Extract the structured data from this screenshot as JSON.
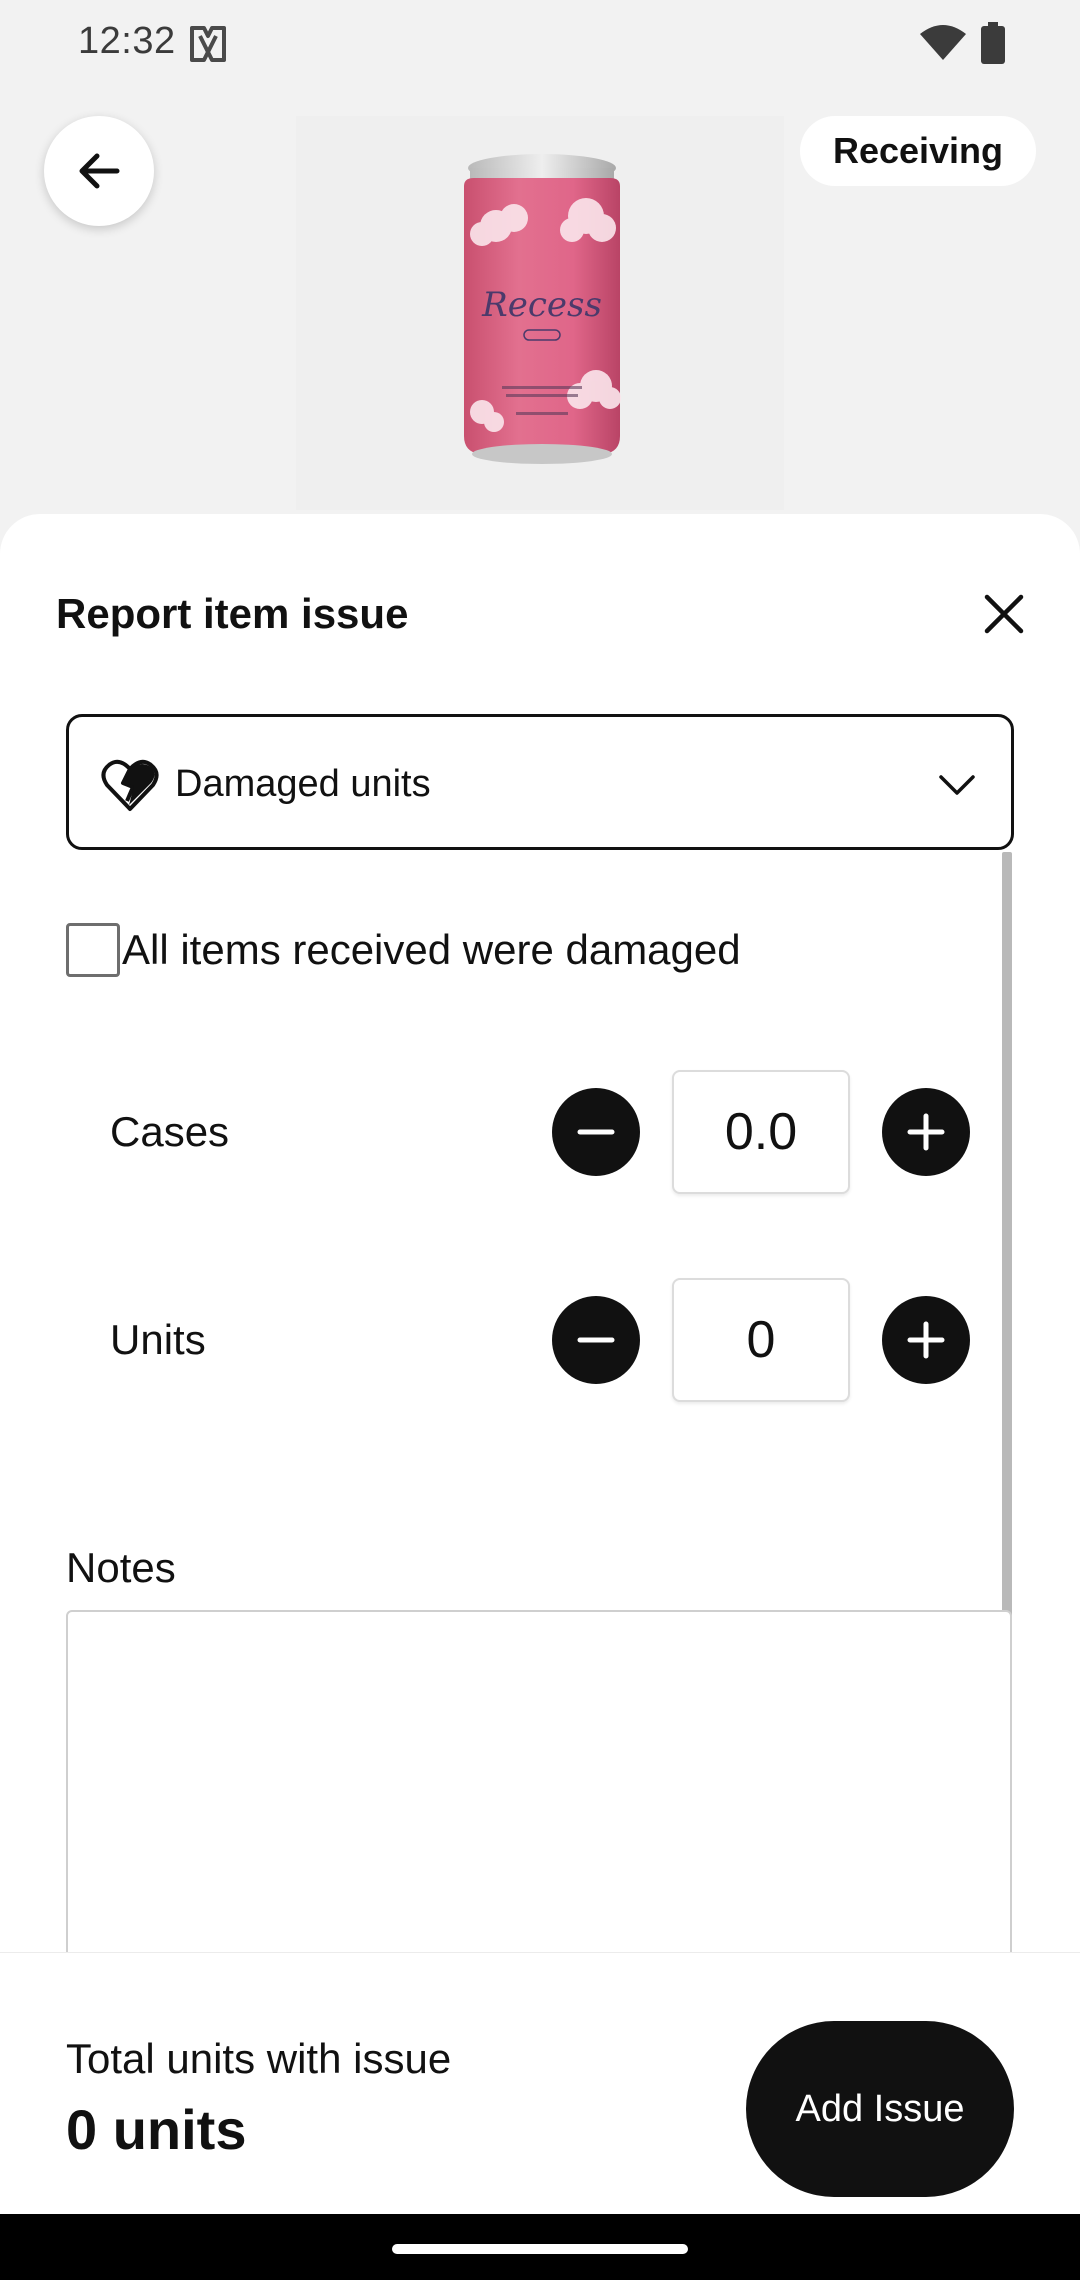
{
  "status_bar": {
    "time": "12:32",
    "app_icon": "app-logo-icon",
    "wifi_icon": "wifi-icon",
    "battery_icon": "battery-icon"
  },
  "header": {
    "back_icon": "arrow-left-icon",
    "chip_label": "Receiving",
    "product_image": "Recess sparkling water can"
  },
  "sheet": {
    "title": "Report item issue",
    "close_icon": "close-icon",
    "issue_type": {
      "selected": "Damaged units",
      "icon": "broken-heart-icon",
      "dropdown_icon": "chevron-down-icon"
    },
    "all_damaged": {
      "label": "All items received were damaged",
      "checked": false
    },
    "quantities": [
      {
        "label": "Cases",
        "value": "0.0"
      },
      {
        "label": "Units",
        "value": "0"
      }
    ],
    "notes": {
      "label": "Notes",
      "value": ""
    }
  },
  "footer": {
    "total_label": "Total units with issue",
    "total_value": "0 units",
    "button_label": "Add Issue"
  },
  "colors": {
    "background": "#f2f2f2",
    "sheet": "#ffffff",
    "primary": "#111111",
    "can_pink": "#e2668c"
  }
}
